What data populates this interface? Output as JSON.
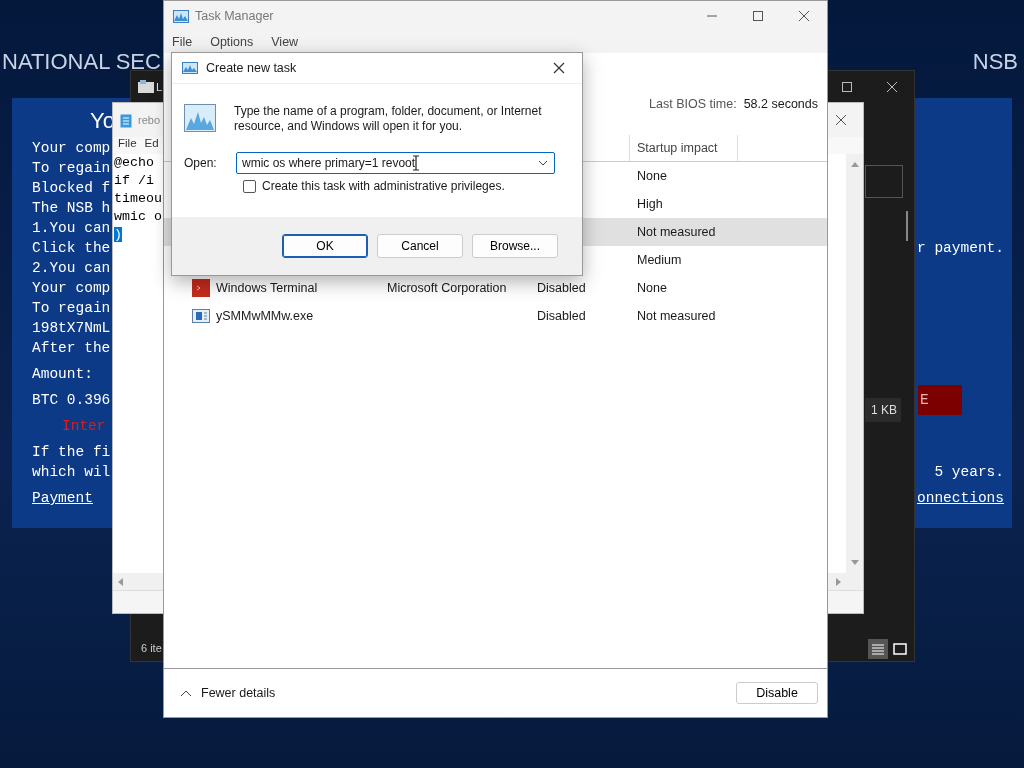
{
  "desktop": {
    "heading_left": "NATIONAL SEC",
    "heading_right": "NSB"
  },
  "ransom_note": {
    "title": "Yo",
    "paragraphs": [
      {
        "rows": [
          {
            "text": "Your comp",
            "kind": "text"
          },
          {
            "text": "To regain",
            "kind": "text"
          },
          {
            "text": "Blocked f",
            "kind": "text"
          },
          {
            "text": "The NSB h",
            "kind": "text"
          },
          {
            "text": "1.You can",
            "kind": "text"
          },
          {
            "text": "Click the",
            "kind": "text",
            "right": {
              "text": "r payment.",
              "kind": "text"
            }
          },
          {
            "text": "2.You can",
            "kind": "text"
          },
          {
            "text": "Your comp",
            "kind": "text"
          },
          {
            "text": "To regain",
            "kind": "text"
          },
          {
            "text": "198tX7NmL",
            "kind": "text"
          },
          {
            "text": "After the",
            "kind": "text"
          }
        ]
      },
      {
        "rows": [
          {
            "text": "Amount:",
            "kind": "text"
          }
        ]
      },
      {
        "rows": [
          {
            "text": "BTC 0.396",
            "kind": "text",
            "right": {
              "text": "E",
              "kind": "button"
            }
          }
        ]
      },
      {
        "rows": [
          {
            "text": "Inter",
            "kind": "alert"
          }
        ]
      },
      {
        "rows": [
          {
            "text": "If the fi",
            "kind": "text"
          },
          {
            "text": "which wil",
            "kind": "text",
            "right": {
              "text": "5 years.",
              "kind": "text"
            }
          }
        ]
      },
      {
        "rows": [
          {
            "text": "Payment",
            "kind": "link",
            "right": {
              "text": "onnections",
              "kind": "link"
            }
          }
        ]
      }
    ]
  },
  "explorer": {
    "title": "L",
    "size_cell": "1 KB",
    "status": "6 ite"
  },
  "notepad": {
    "title": "rebo",
    "menu": [
      "File",
      "Ed"
    ],
    "lines": [
      {
        "text": "@echo",
        "selected": false
      },
      {
        "text": "if /i",
        "selected": false
      },
      {
        "text": "timeou",
        "selected": false
      },
      {
        "text": "wmic o",
        "selected": false
      },
      {
        "text": ")",
        "selected": true
      }
    ]
  },
  "task_manager": {
    "title": "Task Manager",
    "menu": [
      "File",
      "Options",
      "View"
    ],
    "bios_label": "Last BIOS time:",
    "bios_value": "58.2 seconds",
    "columns": [
      {
        "label": "Startup impact"
      }
    ],
    "rows": [
      {
        "impact": "None",
        "selected": false
      },
      {
        "impact": "High",
        "selected": false
      },
      {
        "impact": "Not measured",
        "selected": true
      },
      {
        "impact": "Medium",
        "selected": false
      },
      {
        "kind": "terminal",
        "name": "Windows Terminal",
        "publisher": "Microsoft Corporation",
        "status": "Disabled",
        "impact": "None",
        "selected": false
      },
      {
        "kind": "app",
        "name": "ySMMwMMw.exe",
        "status": "Disabled",
        "impact": "Not measured",
        "selected": false
      }
    ],
    "fewer_details": "Fewer details",
    "action_button": "Disable"
  },
  "dialog": {
    "title": "Create new task",
    "description": "Type the name of a program, folder, document, or Internet resource, and Windows will open it for you.",
    "open_label": "Open:",
    "value": "wmic os where primary=1 revoot",
    "admin_checkbox": {
      "label": "Create this task with administrative privileges.",
      "checked": false
    },
    "buttons": [
      {
        "label": "OK",
        "default": true
      },
      {
        "label": "Cancel",
        "default": false
      },
      {
        "label": "Browse...",
        "default": false
      }
    ]
  }
}
